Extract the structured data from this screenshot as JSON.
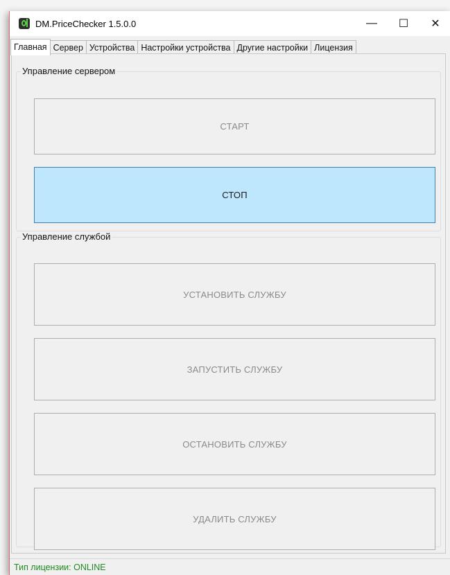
{
  "window": {
    "title": "DM.PriceChecker 1.5.0.0",
    "controls": {
      "minimize": "—",
      "maximize": "☐",
      "close": "✕"
    }
  },
  "tabs": [
    {
      "label": "Главная",
      "active": true
    },
    {
      "label": "Сервер",
      "active": false
    },
    {
      "label": "Устройства",
      "active": false
    },
    {
      "label": "Настройки устройства",
      "active": false
    },
    {
      "label": "Другие настройки",
      "active": false
    },
    {
      "label": "Лицензия",
      "active": false
    }
  ],
  "server_group": {
    "label": "Управление сервером",
    "start_label": "СТАРТ",
    "stop_label": "СТОП"
  },
  "service_group": {
    "label": "Управление службой",
    "install_label": "УСТАНОВИТЬ СЛУЖБУ",
    "start_label": "ЗАПУСТИТЬ СЛУЖБУ",
    "stop_label": "ОСТАНОВИТЬ СЛУЖБУ",
    "delete_label": "УДАЛИТЬ СЛУЖБУ"
  },
  "status": {
    "text": "Тип лицензии: ONLINE",
    "color": "#1f8a1f"
  },
  "colors": {
    "active_button_bg": "#bee6fd",
    "active_button_border": "#3c7fb1",
    "window_accent": "#d86a6a"
  }
}
